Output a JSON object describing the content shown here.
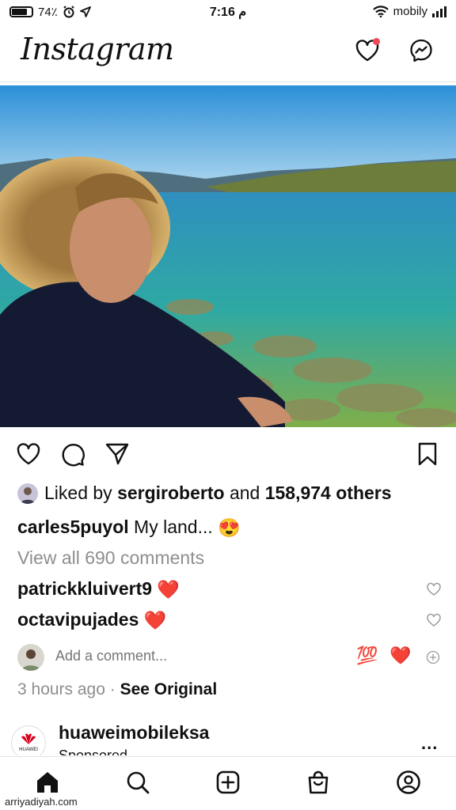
{
  "status_bar": {
    "battery": "74٪",
    "battery_level": 0.74,
    "time": "7:16 م",
    "carrier": "mobily"
  },
  "header": {
    "logo": "Instagram"
  },
  "post": {
    "likes": {
      "prefix": "Liked by",
      "user": "sergiroberto",
      "and": "and",
      "others": "158,974 others"
    },
    "caption": {
      "username": "carles5puyol",
      "text": "My land...",
      "emoji": "😍"
    },
    "view_all_comments": "View all 690 comments",
    "comments": [
      {
        "username": "patrickkluivert9",
        "emoji": "❤️"
      },
      {
        "username": "octavipujades",
        "emoji": "❤️"
      }
    ],
    "add_comment_placeholder": "Add a comment...",
    "quick_reactions": [
      "💯",
      "❤️"
    ],
    "time_ago": "3 hours ago",
    "separator": "·",
    "see_original": "See Original"
  },
  "next_post": {
    "brand_label": "HUAWEI",
    "username": "huaweimobileksa",
    "sponsored": "Sponsored",
    "more": "..."
  },
  "watermark": "arriyadiyah.com",
  "colors": {
    "notification": "#ed4956",
    "secondary_text": "#8e8e8e"
  }
}
